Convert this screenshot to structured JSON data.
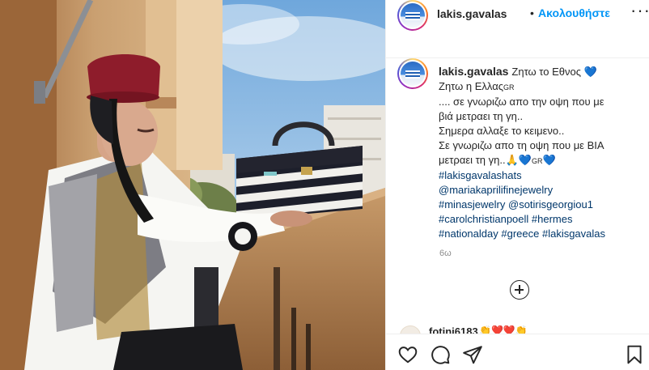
{
  "header": {
    "username": "lakis.gavalas",
    "separator": "•",
    "follow_label": "Ακολουθήστε",
    "more_icon": "more-options-icon"
  },
  "caption": {
    "username": "lakis.gavalas",
    "lines": [
      "Ζητω το Εθνος",
      "Ζητω η Ελλας",
      ".... σε γνωριζω απο την οψη που με",
      "βιά μετραει τη γη..",
      "Σημερα αλλαξε το κειμενο..",
      "Σε γνωριζω απο τη οψη που με ΒΙΑ",
      "μετραει τη γη.."
    ],
    "gr_marker": "GR",
    "emoji_blue_heart": "💙",
    "emoji_pray": "🙏",
    "tags": [
      "#lakisgavalashats",
      "@mariakaprilifinejewelry",
      "#minasjewelry",
      "@sotirisgeorgiou1",
      "#carolchristianpoell",
      "#hermes",
      "#nationalday",
      "#greece",
      "#lakisgavalas"
    ],
    "time": "6ω"
  },
  "comment_peek": {
    "username": "fotini6183",
    "emoji": "👏❤️❤️👏"
  },
  "actions": {
    "like_icon": "heart-icon",
    "comment_icon": "comment-icon",
    "share_icon": "share-icon",
    "save_icon": "bookmark-icon"
  },
  "colors": {
    "link": "#00376b",
    "follow": "#0095f6",
    "heart": "#2f7fe0",
    "time": "#8e8e8e"
  }
}
